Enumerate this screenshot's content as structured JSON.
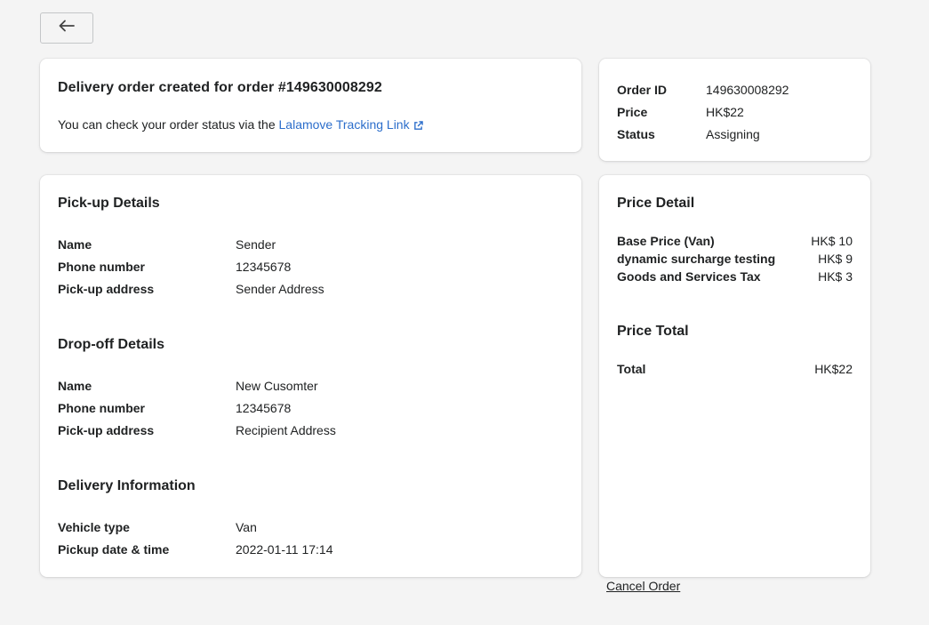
{
  "back_button": {
    "icon": "arrow-left-icon"
  },
  "banner": {
    "title": "Delivery order created for order #149630008292",
    "text_prefix": "You can check your order status via the ",
    "link_label": "Lalamove Tracking Link"
  },
  "summary": {
    "rows": [
      {
        "label": "Order ID",
        "value": "149630008292"
      },
      {
        "label": "Price",
        "value": "HK$22"
      },
      {
        "label": "Status",
        "value": "Assigning"
      }
    ]
  },
  "pickup": {
    "title": "Pick-up Details",
    "rows": [
      {
        "label": "Name",
        "value": "Sender"
      },
      {
        "label": "Phone number",
        "value": "12345678"
      },
      {
        "label": "Pick-up address",
        "value": "Sender Address"
      }
    ]
  },
  "dropoff": {
    "title": "Drop-off Details",
    "rows": [
      {
        "label": "Name",
        "value": "New Cusomter"
      },
      {
        "label": "Phone number",
        "value": "12345678"
      },
      {
        "label": "Pick-up address",
        "value": "Recipient Address"
      }
    ]
  },
  "delivery": {
    "title": "Delivery Information",
    "rows": [
      {
        "label": "Vehicle type",
        "value": "Van"
      },
      {
        "label": "Pickup date & time",
        "value": "2022-01-11 17:14"
      }
    ]
  },
  "price_detail": {
    "title": "Price Detail",
    "rows": [
      {
        "label": "Base Price (Van)",
        "value": "HK$ 10"
      },
      {
        "label": "dynamic surcharge testing",
        "value": "HK$ 9"
      },
      {
        "label": "Goods and Services Tax",
        "value": "HK$ 3"
      }
    ]
  },
  "price_total": {
    "title": "Price Total",
    "label": "Total",
    "value": "HK$22"
  },
  "cancel_order_label": "Cancel Order",
  "colors": {
    "link": "#2c6ecb",
    "background": "#f4f4f4",
    "card": "#ffffff"
  }
}
